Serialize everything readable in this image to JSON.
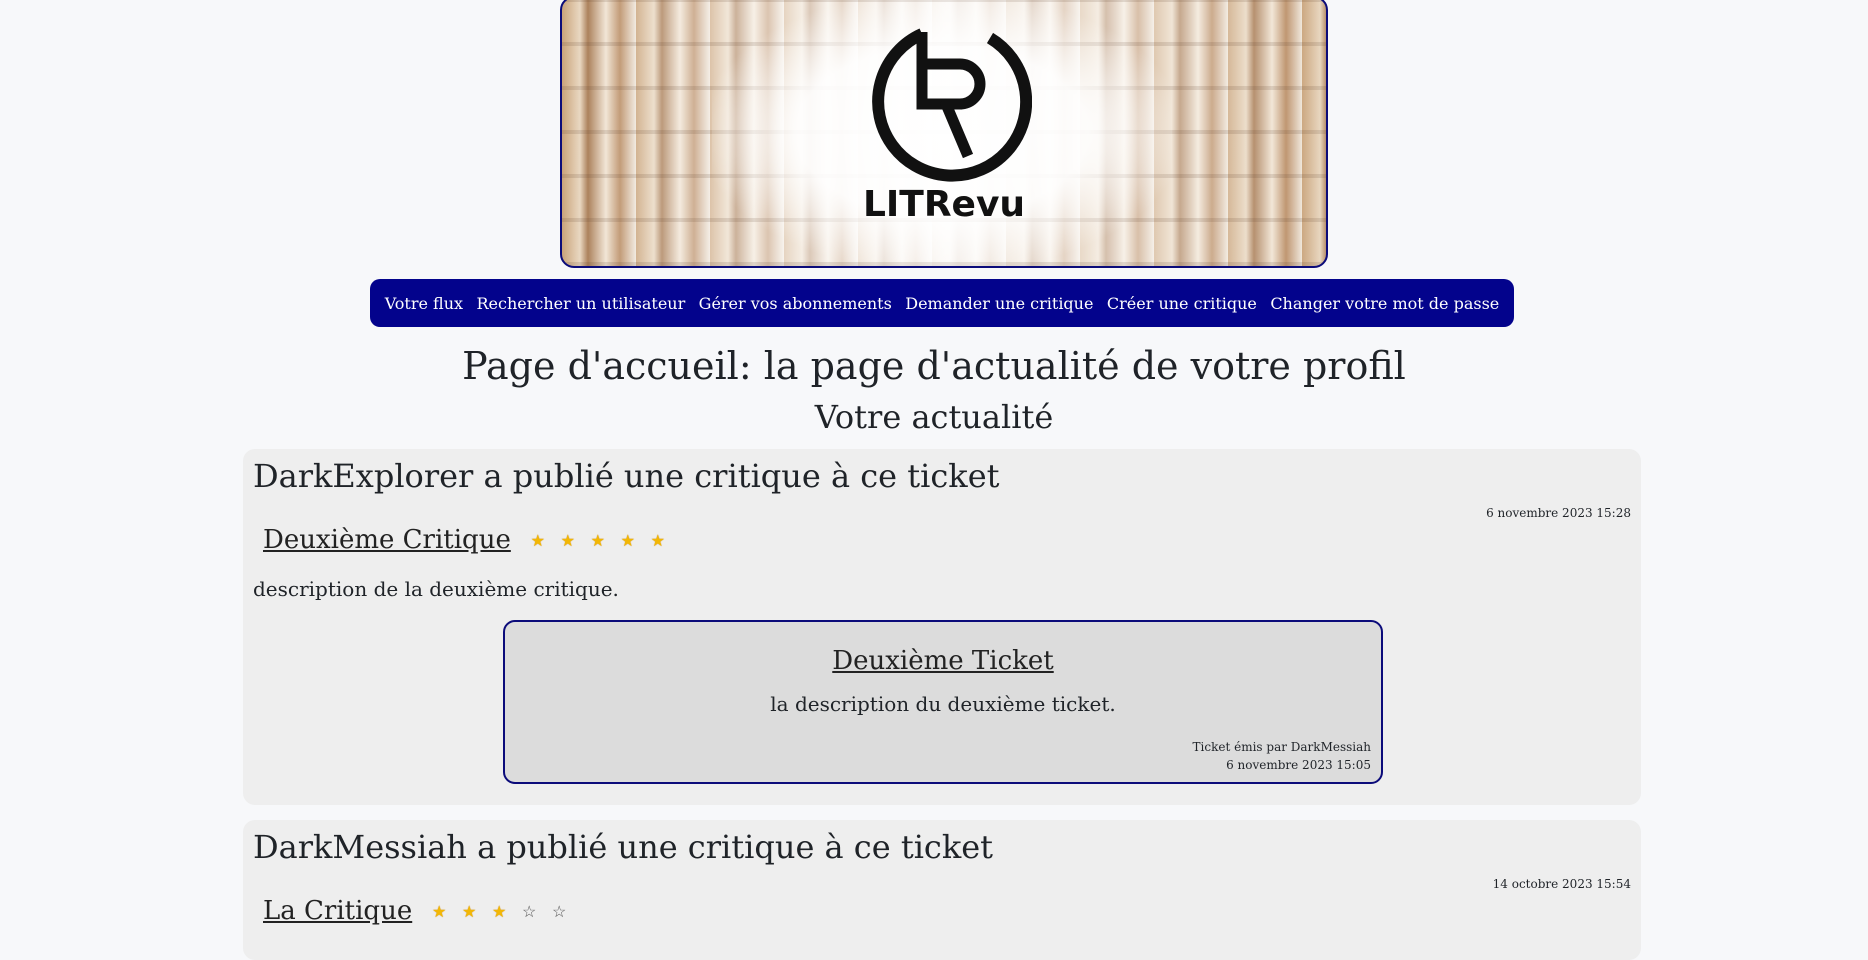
{
  "banner": {
    "logo_text": "LITRevu"
  },
  "nav": {
    "items": [
      "Votre flux",
      "Rechercher un utilisateur",
      "Gérer vos abonnements",
      "Demander une critique",
      "Créer une critique",
      "Changer votre mot de passe"
    ]
  },
  "page": {
    "title": "Page d'accueil: la page d'actualité de votre profil",
    "subtitle": "Votre actualité"
  },
  "posts": [
    {
      "heading": "DarkExplorer a publié une critique à ce ticket",
      "date": "6 novembre 2023 15:28",
      "review_title": "Deuxième Critique",
      "rating": 5,
      "max_rating": 5,
      "description": "description de la deuxième critique.",
      "ticket": {
        "title": "Deuxième Ticket",
        "description": "la description du deuxième ticket.",
        "issued_by": "Ticket émis par DarkMessiah",
        "date": "6 novembre 2023 15:05"
      }
    },
    {
      "heading": "DarkMessiah a publié une critique à ce ticket",
      "date": "14 octobre 2023 15:54",
      "review_title": "La Critique",
      "rating": 3,
      "max_rating": 5
    }
  ],
  "colors": {
    "nav_bg": "#03038c",
    "border": "#0b0b7a",
    "star": "#f2b705"
  }
}
